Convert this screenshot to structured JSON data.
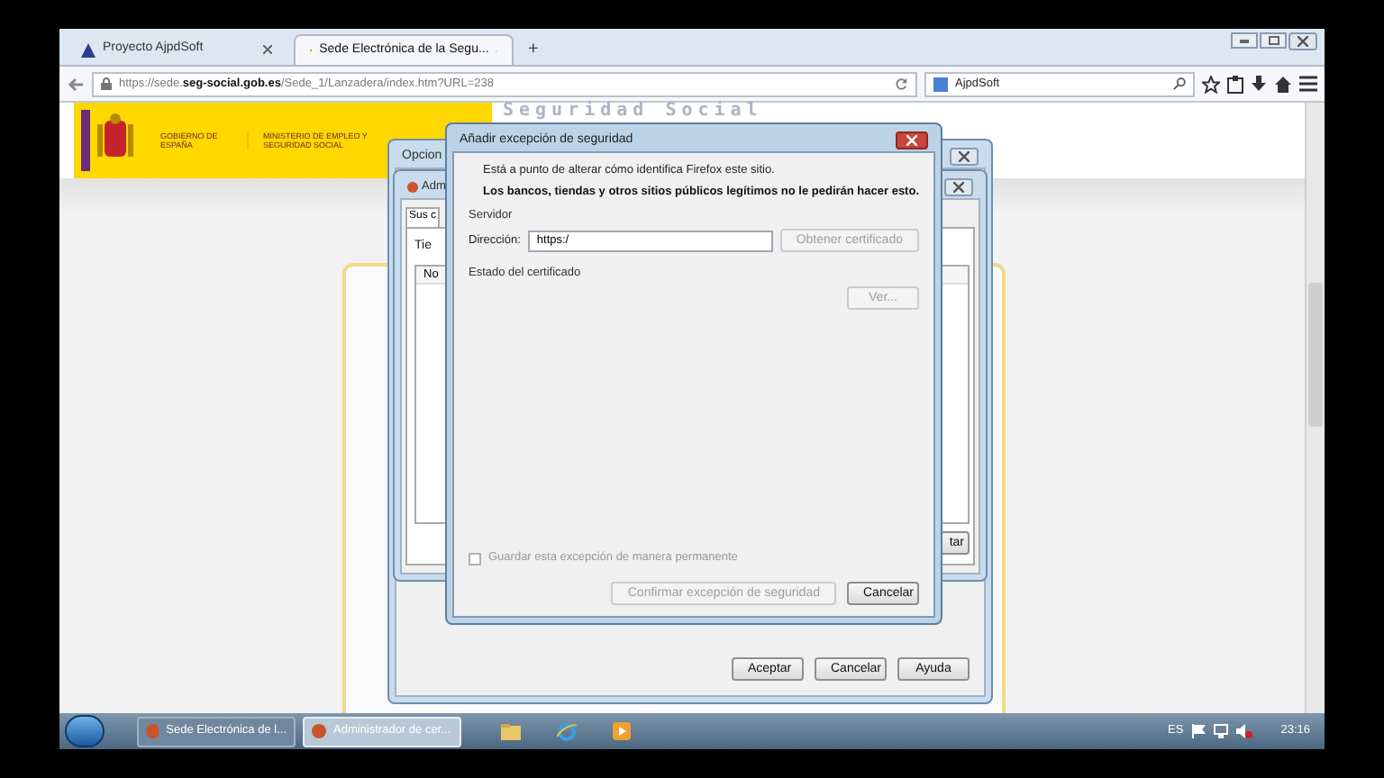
{
  "browser": {
    "tabs": [
      {
        "label": "Proyecto AjpdSoft",
        "selected": false
      },
      {
        "label": "Sede Electrónica de la Segu...",
        "selected": true
      }
    ],
    "new_tab": "+",
    "url": {
      "prefix": "https://sede.",
      "domain": "seg-social.gob.es",
      "path": "/Sede_1/Lanzadera/index.htm?URL=238"
    },
    "search": {
      "value": "AjpdSoft"
    }
  },
  "page": {
    "logo_left": "GOBIERNO DE ESPAÑA",
    "logo_right": "MINISTERIO DE EMPLEO Y SEGURIDAD SOCIAL",
    "brand": "Seguridad Social"
  },
  "options_window": {
    "title": "Opcion",
    "buttons": [
      "Aceptar",
      "Cancelar",
      "Ayuda"
    ]
  },
  "cert_window": {
    "title": "Adm",
    "tab": "Sus c",
    "label": "Tie",
    "column": "No",
    "button": "tar"
  },
  "dialog": {
    "title": "Añadir excepción de seguridad",
    "warning": "Está a punto de alterar cómo identifica Firefox este sitio.",
    "warning_bold": "Los bancos, tiendas y otros sitios públicos legítimos no le pedirán hacer esto.",
    "server_heading": "Servidor",
    "address_label": "Dirección:",
    "address_value": "https:/",
    "get_cert_button": {
      "label": "Obtener certificado",
      "disabled": true
    },
    "status_heading": "Estado del certificado",
    "view_button": {
      "label": "Ver...",
      "disabled": true
    },
    "permanent": {
      "label": "Guardar esta excepción de manera permanente",
      "checked": false,
      "disabled": true
    },
    "confirm_button": {
      "label": "Confirmar excepción de seguridad",
      "disabled": true
    },
    "cancel_button": "Cancelar"
  },
  "taskbar": {
    "tasks": [
      {
        "label": "Sede Electrónica de l...",
        "selected": false
      },
      {
        "label": "Administrador de cer...",
        "selected": true
      }
    ],
    "language": "ES",
    "clock": "23:16"
  }
}
